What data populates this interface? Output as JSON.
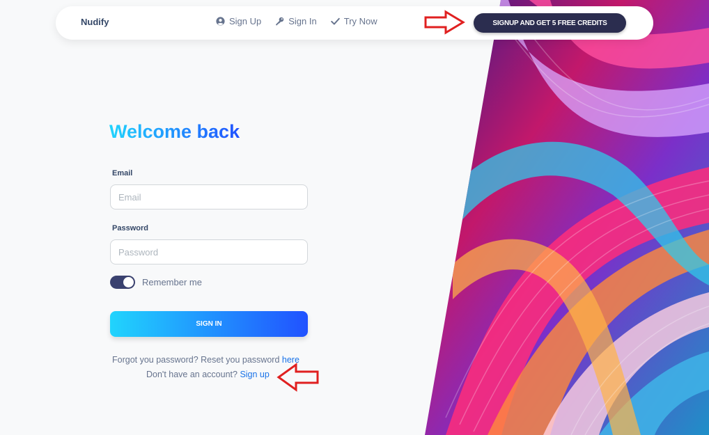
{
  "navbar": {
    "brand": "Nudify",
    "links": [
      {
        "label": "Sign Up",
        "icon": "user-circle-icon"
      },
      {
        "label": "Sign In",
        "icon": "key-icon"
      },
      {
        "label": "Try Now",
        "icon": "checkmark-icon"
      }
    ],
    "cta_label": "SIGNUP AND GET 5 FREE CREDITS"
  },
  "form": {
    "title": "Welcome back",
    "email_label": "Email",
    "email_placeholder": "Email",
    "password_label": "Password",
    "password_placeholder": "Password",
    "remember_label": "Remember me",
    "remember_checked": true,
    "signin_label": "SIGN IN",
    "forgot_text": "Forgot you password? Reset you password ",
    "forgot_link": "here",
    "signup_text": "Don't have an account? ",
    "signup_link": "Sign up"
  },
  "colors": {
    "accent_gradient_start": "#21d4fd",
    "accent_gradient_end": "#2152ff",
    "cta_background": "#2b2d4f",
    "annotation_arrow": "#e02020"
  }
}
